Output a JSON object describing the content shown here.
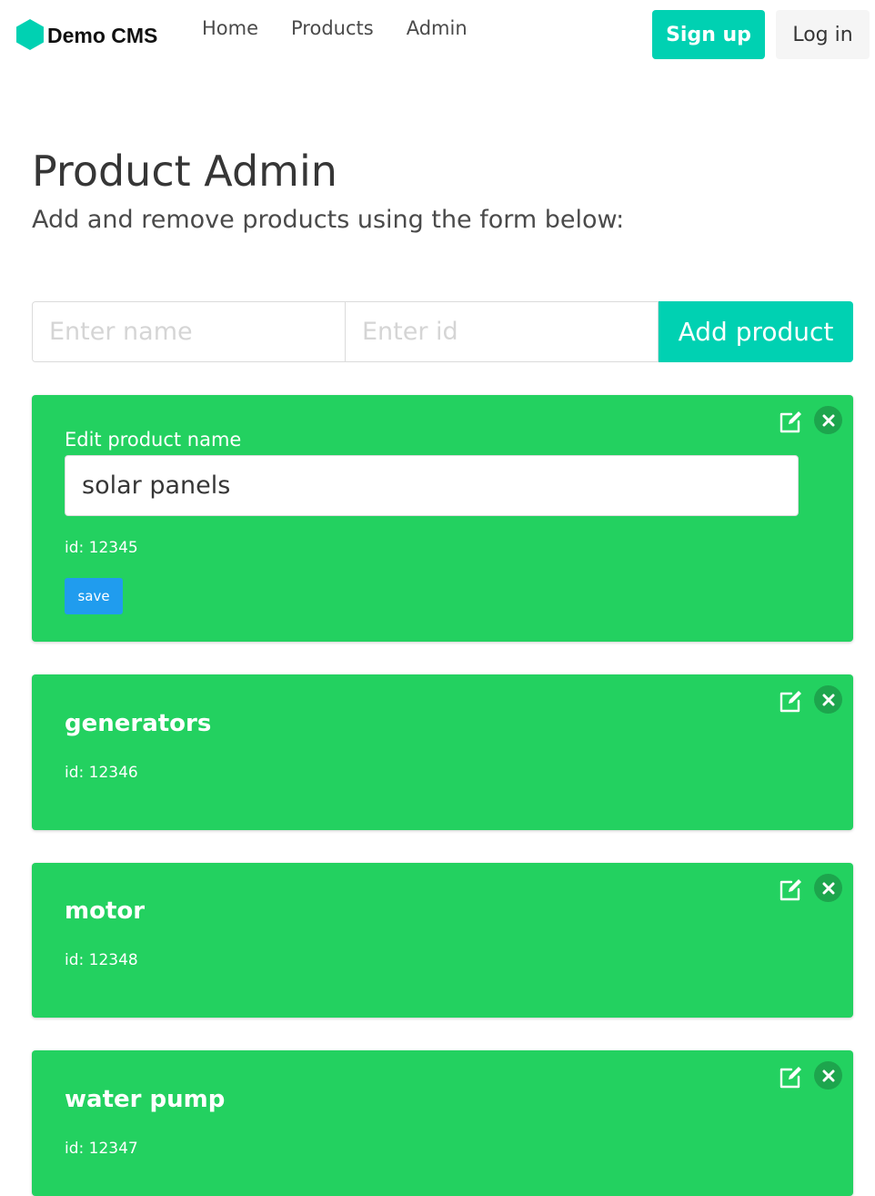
{
  "navbar": {
    "brand": "Demo CMS",
    "links": [
      "Home",
      "Products",
      "Admin"
    ],
    "signup_label": "Sign up",
    "login_label": "Log in"
  },
  "header": {
    "title": "Product Admin",
    "subtitle": "Add and remove products using the form below:"
  },
  "add_form": {
    "name_placeholder": "Enter name",
    "id_placeholder": "Enter id",
    "name_value": "",
    "id_value": "",
    "button_label": "Add product"
  },
  "editing_product": {
    "label": "Edit product name",
    "value": "solar panels",
    "id_text": "id: 12345",
    "save_label": "save"
  },
  "products": [
    {
      "name": "generators",
      "id_text": "id: 12346"
    },
    {
      "name": "motor",
      "id_text": "id: 12348"
    },
    {
      "name": "water pump",
      "id_text": "id: 12347"
    }
  ],
  "icons": {
    "brand": "hexagon-logo-icon",
    "edit": "edit-icon",
    "delete": "close-icon"
  },
  "colors": {
    "primary": "#00d1b2",
    "success": "#23d160",
    "info": "#209cee",
    "light": "#f5f5f5"
  }
}
